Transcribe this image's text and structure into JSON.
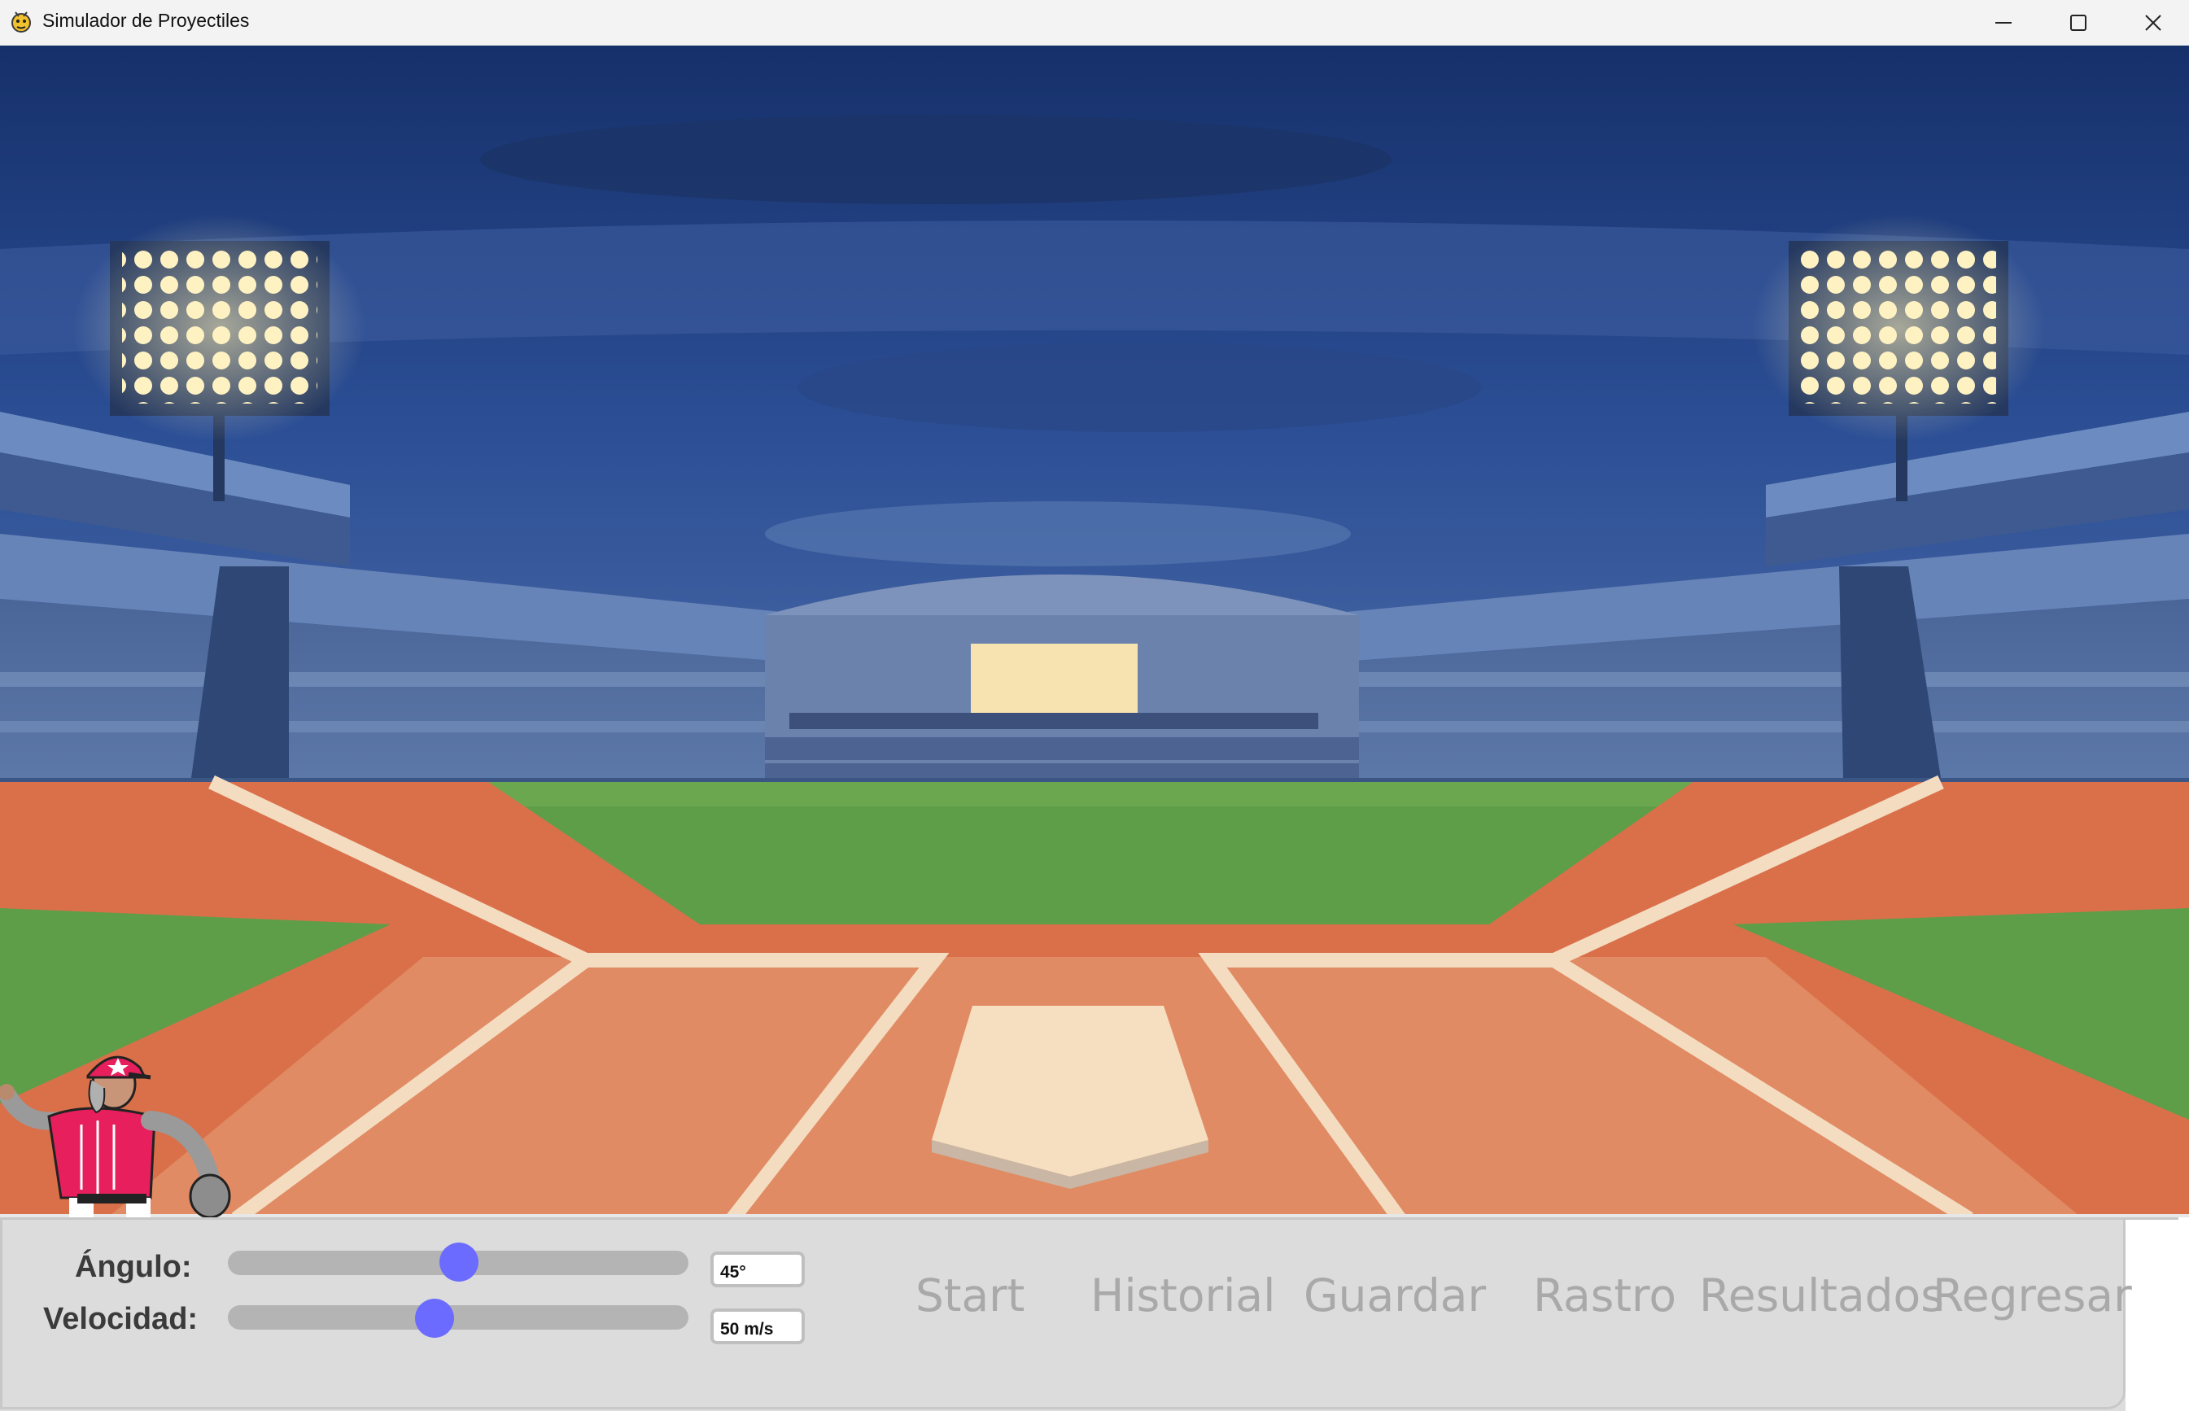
{
  "window": {
    "title": "Simulador de Proyectiles",
    "app_icon": "pygame-snake-icon",
    "controls": [
      "minimize-icon",
      "maximize-icon",
      "close-icon"
    ]
  },
  "scene": {
    "description_icons": [
      "stadium-background",
      "pitcher-sprite"
    ]
  },
  "controls": {
    "angle": {
      "label": "Ángulo:",
      "value_text": "45°",
      "slider_fraction": 0.5
    },
    "velocity": {
      "label": "Velocidad:",
      "value_text": "50 m/s",
      "slider_fraction": 0.45
    }
  },
  "buttons": {
    "start": "Start",
    "history": "Historial",
    "save": "Guardar",
    "trace": "Rastro",
    "results": "Resultados",
    "back": "Regresar"
  },
  "colors": {
    "slider_thumb": "#6b6bff",
    "button_text": "#a9a9a9",
    "panel_bg": "#dcdcdc"
  }
}
